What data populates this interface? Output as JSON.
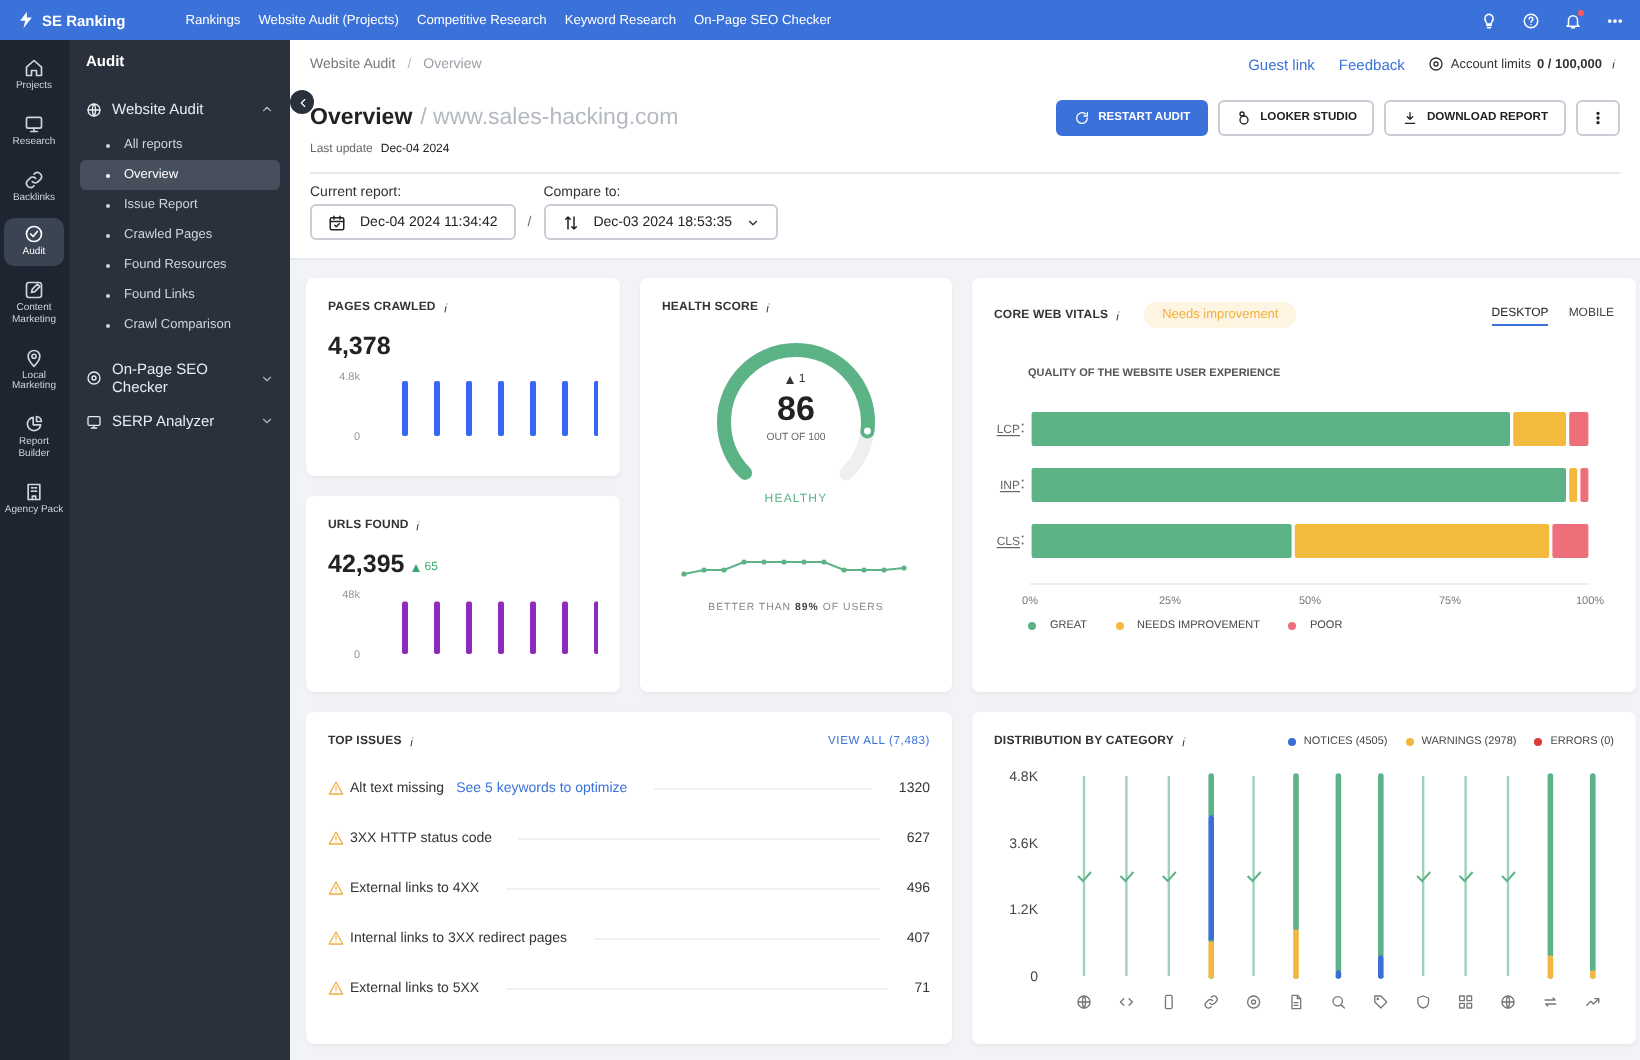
{
  "topbar": {
    "logo": "SE Ranking",
    "nav": [
      {
        "label": "Rankings"
      },
      {
        "label": "Website Audit (Projects)"
      },
      {
        "label": "Competitive Research"
      },
      {
        "label": "Keyword Research"
      },
      {
        "label": "On-Page SEO Checker"
      }
    ]
  },
  "rail": [
    {
      "label": "Projects",
      "selected": false
    },
    {
      "label": "Research",
      "selected": false
    },
    {
      "label": "Backlinks",
      "selected": false
    },
    {
      "label": "Audit",
      "selected": true
    },
    {
      "label": "Content Marketing",
      "selected": false
    },
    {
      "label": "Local Marketing",
      "selected": false
    },
    {
      "label": "Report Builder",
      "selected": false
    },
    {
      "label": "Agency Pack",
      "selected": false
    }
  ],
  "sidebar": {
    "title": "Audit",
    "sections": [
      {
        "label": "Website Audit",
        "expanded": true,
        "children": [
          {
            "label": "All reports",
            "selected": false
          },
          {
            "label": "Overview",
            "selected": true
          },
          {
            "label": "Issue Report",
            "selected": false
          },
          {
            "label": "Crawled Pages",
            "selected": false
          },
          {
            "label": "Found Resources",
            "selected": false
          },
          {
            "label": "Found Links",
            "selected": false
          },
          {
            "label": "Crawl Comparison",
            "selected": false
          }
        ]
      },
      {
        "label": "On-Page SEO Checker",
        "expanded": false
      },
      {
        "label": "SERP Analyzer",
        "expanded": false
      }
    ]
  },
  "header": {
    "breadcrumb": [
      "Website Audit",
      "Overview"
    ],
    "breadcrumb_separator": "/",
    "links": [
      "Guest link",
      "Feedback"
    ],
    "account_limits": {
      "label": "Account limits",
      "value": "0 / 100,000"
    },
    "title": "Overview",
    "site": "/ www.sales-hacking.com",
    "last_update": {
      "label": "Last update",
      "value": "Dec-04 2024"
    },
    "buttons": [
      {
        "label": "RESTART AUDIT",
        "kind": "primary"
      },
      {
        "label": "LOOKER STUDIO",
        "kind": "looker"
      },
      {
        "label": "DOWNLOAD REPORT",
        "kind": "download"
      }
    ],
    "current_report": {
      "label": "Current report:",
      "value": "Dec-04 2024 11:34:42"
    },
    "separator": "/",
    "compare_to": {
      "label": "Compare to:",
      "value": "Dec-03 2024 18:53:35"
    }
  },
  "pages_crawled": {
    "title": "PAGES CRAWLED",
    "value": "4,378",
    "chart_data": {
      "type": "bar",
      "series": [
        {
          "color": "#3566f5",
          "values": [
            4400,
            4400,
            4400,
            4400,
            4400,
            4400,
            4400
          ]
        }
      ],
      "ylim": [
        0,
        4800
      ],
      "yticks": [
        {
          "value": 4800,
          "label": "4.8k"
        },
        {
          "value": 0,
          "label": "0"
        }
      ]
    }
  },
  "urls_found": {
    "title": "URLS FOUND",
    "value": "42,395",
    "delta": "65",
    "chart_data": {
      "type": "bar",
      "series": [
        {
          "color": "#8e2bbd",
          "values": [
            42000,
            42000,
            42000,
            42000,
            42000,
            42000,
            42000
          ]
        }
      ],
      "ylim": [
        0,
        48000
      ],
      "yticks": [
        {
          "value": 48000,
          "label": "48k"
        },
        {
          "value": 0,
          "label": "0"
        }
      ]
    }
  },
  "health_score": {
    "title": "HEALTH SCORE",
    "delta": "1",
    "score": "86",
    "out_of": "OUT OF 100",
    "level": 0.86,
    "status": "HEALTHY",
    "comparison": "BETTER THAN **89%** OF USERS"
  },
  "core_web_vitals": {
    "title": "CORE WEB VITALS",
    "badge": "Needs improvement",
    "tabs": [
      {
        "label": "DESKTOP",
        "selected": true
      },
      {
        "label": "MOBILE",
        "selected": false
      }
    ],
    "chart_data": {
      "type": "bar",
      "orientation": "horizontal",
      "stacked": true,
      "title": "QUALITY OF THE WEBSITE USER EXPERIENCE",
      "categories": [
        "LCP",
        "INP",
        "CLS"
      ],
      "series": [
        {
          "name": "GREAT",
          "color": "#5bb386",
          "values": [
            86,
            96,
            47
          ]
        },
        {
          "name": "NEEDS IMPROVEMENT",
          "color": "#f2bb3e",
          "values": [
            10,
            2,
            46
          ]
        },
        {
          "name": "POOR",
          "color": "#ec6f7a",
          "values": [
            4,
            2,
            7
          ]
        }
      ],
      "legend": "bottom",
      "xlim": [
        0,
        100
      ],
      "xticks": [
        {
          "value": 0,
          "label": "0%"
        },
        {
          "value": 25,
          "label": "25%"
        },
        {
          "value": 50,
          "label": "50%"
        },
        {
          "value": 75,
          "label": "75%"
        },
        {
          "value": 100,
          "label": "100%"
        }
      ]
    }
  },
  "top_issues": {
    "title": "TOP ISSUES",
    "view_all": "VIEW ALL (7,483)",
    "rows": [
      {
        "text": "Alt text missing",
        "link": "See 5 keywords to optimize",
        "count": "1320"
      },
      {
        "text": "3XX HTTP status code",
        "count": "627"
      },
      {
        "text": "External links to 4XX",
        "count": "496"
      },
      {
        "text": "Internal links to 3XX redirect pages",
        "count": "407"
      },
      {
        "text": "External links to 5XX",
        "count": "71"
      }
    ]
  },
  "distribution": {
    "title": "DISTRIBUTION BY CATEGORY",
    "legend": [
      {
        "label": "NOTICES (4505)",
        "color": "#3b6fd6"
      },
      {
        "label": "WARNINGS (2978)",
        "color": "#f3b63f"
      },
      {
        "label": "ERRORS (0)",
        "color": "#d93a3a"
      }
    ],
    "y_labels": [
      "4.8K",
      "3.6K",
      "1.2K",
      "0"
    ]
  }
}
